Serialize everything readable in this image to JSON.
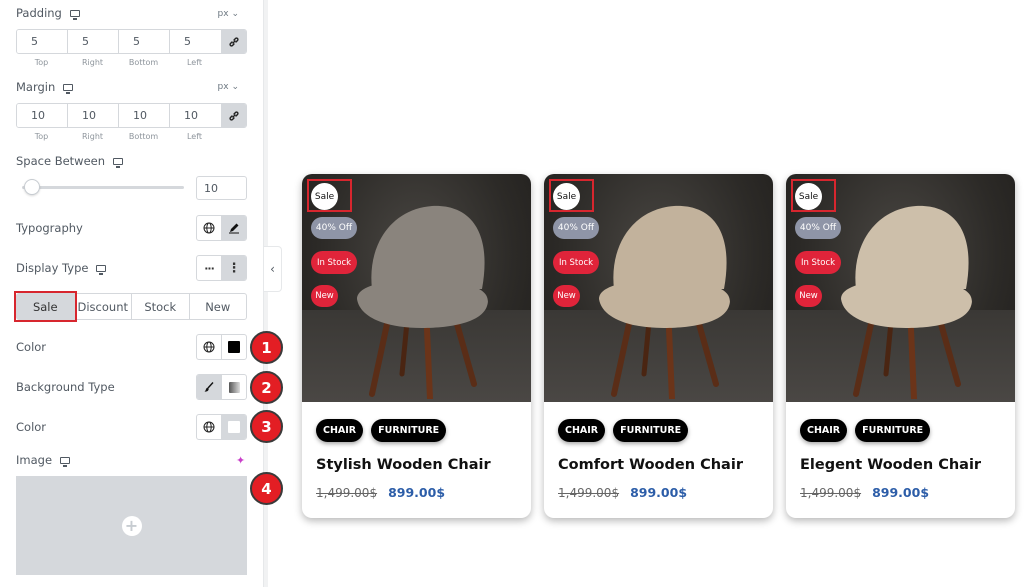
{
  "sidebar": {
    "padding": {
      "label": "Padding",
      "unit": "px",
      "top": "5",
      "right": "5",
      "bottom": "5",
      "left": "5"
    },
    "margin": {
      "label": "Margin",
      "unit": "px",
      "top": "10",
      "right": "10",
      "bottom": "10",
      "left": "10"
    },
    "dim_labels": {
      "top": "Top",
      "right": "Right",
      "bottom": "Bottom",
      "left": "Left"
    },
    "space_between": {
      "label": "Space Between",
      "value": "10"
    },
    "typography": {
      "label": "Typography"
    },
    "display_type": {
      "label": "Display Type"
    },
    "tabs": [
      "Sale",
      "Discount",
      "Stock",
      "New"
    ],
    "color_1": {
      "label": "Color"
    },
    "background_type": {
      "label": "Background Type"
    },
    "color_2": {
      "label": "Color"
    },
    "image": {
      "label": "Image"
    },
    "collapse_glyph": "‹",
    "steps": [
      "1",
      "2",
      "3",
      "4"
    ]
  },
  "products": [
    {
      "badges": {
        "sale": "Sale",
        "off": "40% Off",
        "stock": "In Stock",
        "new": "New"
      },
      "tags": [
        "CHAIR",
        "FURNITURE"
      ],
      "title": "Stylish Wooden Chair",
      "old_price": "1,499.00$",
      "price": "899.00$",
      "fabric": "#8a847d"
    },
    {
      "badges": {
        "sale": "Sale",
        "off": "40% Off",
        "stock": "In Stock",
        "new": "New"
      },
      "tags": [
        "CHAIR",
        "FURNITURE"
      ],
      "title": "Comfort Wooden Chair",
      "old_price": "1,499.00$",
      "price": "899.00$",
      "fabric": "#c2b29c"
    },
    {
      "badges": {
        "sale": "Sale",
        "off": "40% Off",
        "stock": "In Stock",
        "new": "New"
      },
      "tags": [
        "CHAIR",
        "FURNITURE"
      ],
      "title": "Elegent Wooden Chair",
      "old_price": "1,499.00$",
      "price": "899.00$",
      "fabric": "#cdbfaa"
    }
  ],
  "colors": {
    "accent_red": "#e31e24",
    "price_blue": "#2c5da8",
    "badge_red": "#e0243a",
    "badge_grey": "#8f95a7"
  }
}
